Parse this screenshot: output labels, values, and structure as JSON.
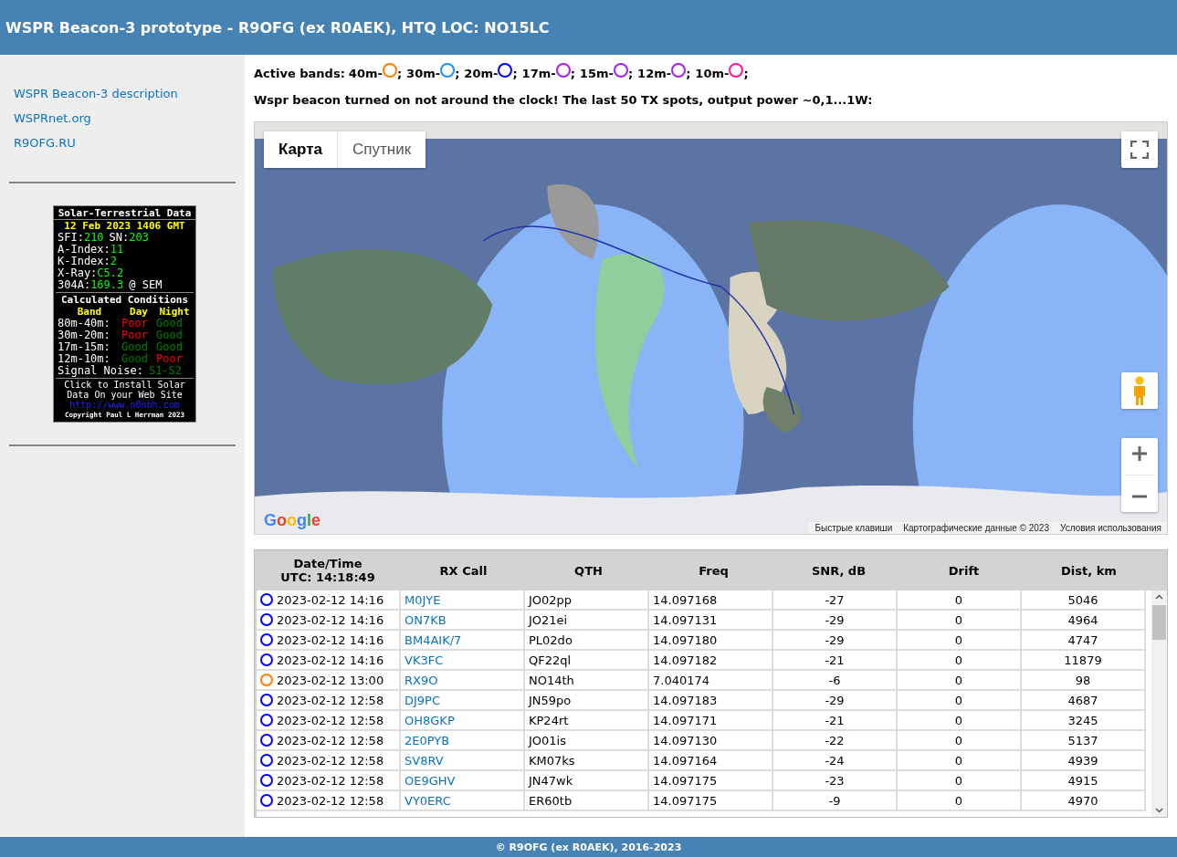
{
  "header": {
    "title": "WSPR Beacon-3 prototype - R9OFG (ex R0AEK), HTQ LOC: NO15LC"
  },
  "sidebar": {
    "links": [
      "WSPR Beacon-3 description",
      "WSPRnet.org",
      "R9OFG.RU"
    ]
  },
  "solar": {
    "title": "Solar-Terrestrial Data",
    "date": "12 Feb 2023 1406 GMT",
    "lines": [
      [
        {
          "kind": "label",
          "text": "SFI:"
        },
        {
          "kind": "value",
          "text": "210"
        },
        {
          "kind": "label",
          "text": "SN:"
        },
        {
          "kind": "value",
          "text": "203"
        }
      ],
      [
        {
          "kind": "label",
          "text": "A-Index:"
        },
        {
          "kind": "value",
          "text": "11"
        }
      ],
      [
        {
          "kind": "label",
          "text": "K-Index:"
        },
        {
          "kind": "value",
          "text": "2"
        }
      ],
      [
        {
          "kind": "label",
          "text": "X-Ray:"
        },
        {
          "kind": "value",
          "text": "C5.2"
        }
      ],
      [
        {
          "kind": "label",
          "text": "304A:"
        },
        {
          "kind": "value",
          "text": "169.3"
        },
        {
          "kind": "label",
          "text": "@ SEM"
        }
      ]
    ],
    "conditions_title": "Calculated Conditions",
    "columns": [
      "Band",
      "Day",
      "Night"
    ],
    "conditions": [
      {
        "band": "80m-40m:",
        "day": {
          "text": "Poor",
          "color": "#ff0000"
        },
        "night": {
          "text": "Good",
          "color": "#008000"
        }
      },
      {
        "band": "30m-20m:",
        "day": {
          "text": "Poor",
          "color": "#ff0000"
        },
        "night": {
          "text": "Good",
          "color": "#008000"
        }
      },
      {
        "band": "17m-15m:",
        "day": {
          "text": "Good",
          "color": "#008000"
        },
        "night": {
          "text": "Good",
          "color": "#008000"
        }
      },
      {
        "band": "12m-10m:",
        "day": {
          "text": "Good",
          "color": "#008000"
        },
        "night": {
          "text": "Poor",
          "color": "#ff0000"
        }
      }
    ],
    "noise_label": "Signal Noise:",
    "noise_value": "S1-S2",
    "install": [
      "Click to Install Solar",
      "Data On your Web Site"
    ],
    "link": "http://www.n0nbh.com",
    "copyright": "Copyright Paul L Herrman 2023"
  },
  "bands": {
    "label": "Active bands:",
    "items": [
      {
        "name": "40m-",
        "color": "#ff7f00",
        "sep": ";"
      },
      {
        "name": "30m-",
        "color": "#1e90ff",
        "sep": ";"
      },
      {
        "name": "20m-",
        "color": "#0000ff",
        "sep": ";"
      },
      {
        "name": "17m-",
        "color": "#a020f0",
        "sep": ";"
      },
      {
        "name": "15m-",
        "color": "#a020f0",
        "sep": ";"
      },
      {
        "name": "12m-",
        "color": "#a020f0",
        "sep": ";"
      },
      {
        "name": "10m-",
        "color": "#ff1493",
        "sep": ";"
      }
    ]
  },
  "intro": "Wspr beacon turned on not around the clock! The last 50 TX spots, output power ~0,1...1W:",
  "map": {
    "map_types": [
      {
        "label": "Карта",
        "selected": true
      },
      {
        "label": "Спутник",
        "selected": false
      }
    ],
    "logo": "Google",
    "attribution": [
      "Быстрые клавиши",
      "Картографические данные © 2023",
      "Условия использования"
    ]
  },
  "table": {
    "columns": [
      {
        "label": "Date/Time",
        "sub": "UTC: 14:18:49"
      },
      {
        "label": "RX Call"
      },
      {
        "label": "QTH"
      },
      {
        "label": "Freq"
      },
      {
        "label": "SNR, dB"
      },
      {
        "label": "Drift"
      },
      {
        "label": "Dist, km"
      }
    ],
    "rows": [
      {
        "color": "#0000ff",
        "time": "2023-02-12 14:16",
        "call": "M0JYE",
        "qth": "JO02pp",
        "freq": "14.097168",
        "snr": "-27",
        "drift": "0",
        "dist": "5046"
      },
      {
        "color": "#0000ff",
        "time": "2023-02-12 14:16",
        "call": "ON7KB",
        "qth": "JO21ei",
        "freq": "14.097131",
        "snr": "-29",
        "drift": "0",
        "dist": "4964"
      },
      {
        "color": "#0000ff",
        "time": "2023-02-12 14:16",
        "call": "BM4AIK/7",
        "qth": "PL02do",
        "freq": "14.097180",
        "snr": "-29",
        "drift": "0",
        "dist": "4747"
      },
      {
        "color": "#0000ff",
        "time": "2023-02-12 14:16",
        "call": "VK3FC",
        "qth": "QF22ql",
        "freq": "14.097182",
        "snr": "-21",
        "drift": "0",
        "dist": "11879"
      },
      {
        "color": "#ff7f00",
        "time": "2023-02-12 13:00",
        "call": "RX9O",
        "qth": "NO14th",
        "freq": "7.040174",
        "snr": "-6",
        "drift": "0",
        "dist": "98"
      },
      {
        "color": "#0000ff",
        "time": "2023-02-12 12:58",
        "call": "DJ9PC",
        "qth": "JN59po",
        "freq": "14.097183",
        "snr": "-29",
        "drift": "0",
        "dist": "4687"
      },
      {
        "color": "#0000ff",
        "time": "2023-02-12 12:58",
        "call": "OH8GKP",
        "qth": "KP24rt",
        "freq": "14.097171",
        "snr": "-21",
        "drift": "0",
        "dist": "3245"
      },
      {
        "color": "#0000ff",
        "time": "2023-02-12 12:58",
        "call": "2E0PYB",
        "qth": "JO01is",
        "freq": "14.097130",
        "snr": "-22",
        "drift": "0",
        "dist": "5137"
      },
      {
        "color": "#0000ff",
        "time": "2023-02-12 12:58",
        "call": "SV8RV",
        "qth": "KM07ks",
        "freq": "14.097164",
        "snr": "-24",
        "drift": "0",
        "dist": "4939"
      },
      {
        "color": "#0000ff",
        "time": "2023-02-12 12:58",
        "call": "OE9GHV",
        "qth": "JN47wk",
        "freq": "14.097175",
        "snr": "-23",
        "drift": "0",
        "dist": "4915"
      },
      {
        "color": "#0000ff",
        "time": "2023-02-12 12:58",
        "call": "VY0ERC",
        "qth": "ER60tb",
        "freq": "14.097175",
        "snr": "-9",
        "drift": "0",
        "dist": "4970"
      }
    ]
  },
  "footer": "© R9OFG (ex R0AEK), 2016-2023"
}
